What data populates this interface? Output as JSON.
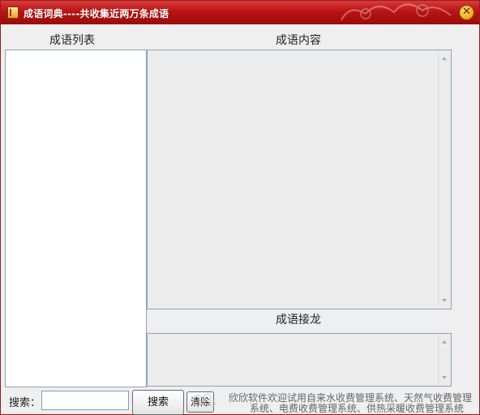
{
  "window": {
    "title": "成语词典----共收集近两万条成语",
    "close_glyph": "✕"
  },
  "labels": {
    "list": "成语列表",
    "content": "成语内容",
    "chain": "成语接龙"
  },
  "search": {
    "label": "搜索：",
    "value": "",
    "button": "搜索",
    "clear": "清除"
  },
  "footer": {
    "line1": "欣欣软件欢迎试用自来水收费管理系统、天然气收费管理",
    "line2": "系统、电费收费管理系统、供热采暖收费管理系统"
  },
  "colors": {
    "titlebar": "#b81414",
    "border": "#8ea3bd",
    "panel": "#ececec"
  }
}
